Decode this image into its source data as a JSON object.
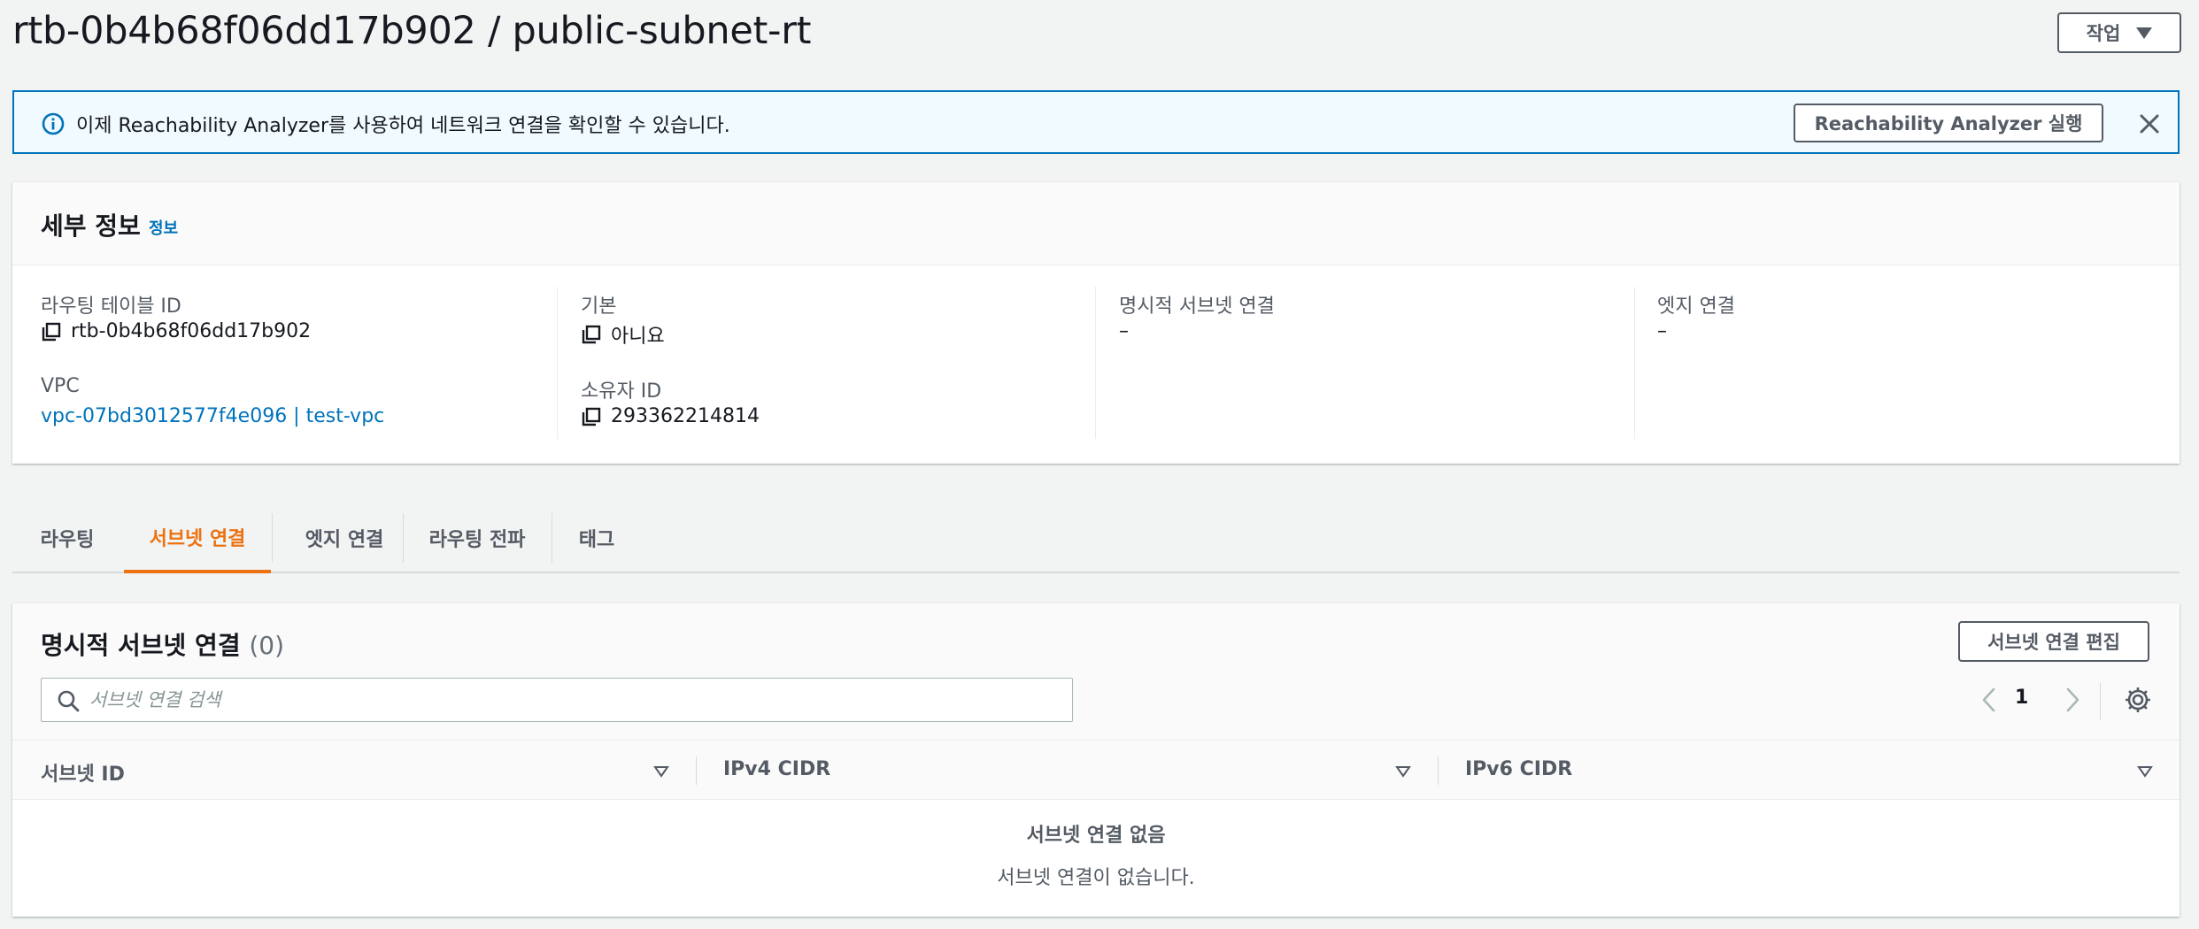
{
  "header": {
    "title": "rtb-0b4b68f06dd17b902 / public-subnet-rt",
    "actions_label": "작업"
  },
  "banner": {
    "icon": "info-icon",
    "text": "이제 Reachability Analyzer를 사용하여 네트워크 연결을 확인할 수 있습니다.",
    "button_label": "Reachability Analyzer 실행",
    "close_icon": "close-icon"
  },
  "details": {
    "title": "세부 정보",
    "info_link": "정보",
    "fields": {
      "route_table_id": {
        "label": "라우팅 테이블 ID",
        "value": "rtb-0b4b68f06dd17b902"
      },
      "vpc": {
        "label": "VPC",
        "value": "vpc-07bd3012577f4e096 | test-vpc"
      },
      "main": {
        "label": "기본",
        "value": "아니요"
      },
      "owner_id": {
        "label": "소유자 ID",
        "value": "293362214814"
      },
      "explicit_subnet": {
        "label": "명시적 서브넷 연결",
        "value": "–"
      },
      "edge_assoc": {
        "label": "엣지 연결",
        "value": "–"
      }
    }
  },
  "tabs": [
    {
      "label": "라우팅",
      "active": false
    },
    {
      "label": "서브넷 연결",
      "active": true
    },
    {
      "label": "엣지 연결",
      "active": false
    },
    {
      "label": "라우팅 전파",
      "active": false
    },
    {
      "label": "태그",
      "active": false
    }
  ],
  "subnet_table": {
    "title": "명시적 서브넷 연결",
    "count": "(0)",
    "edit_button": "서브넷 연결 편집",
    "search": {
      "placeholder": "서브넷 연결 검색",
      "value": ""
    },
    "pagination": {
      "current_page": "1"
    },
    "columns": [
      "서브넷 ID",
      "IPv4 CIDR",
      "IPv6 CIDR"
    ],
    "rows": [],
    "empty_title": "서브넷 연결 없음",
    "empty_description": "서브넷 연결이 없습니다."
  },
  "colors": {
    "accent_orange": "#ec7211",
    "link_blue": "#0073bb",
    "banner_bg": "#f1faff",
    "page_bg": "#f2f3f3"
  }
}
